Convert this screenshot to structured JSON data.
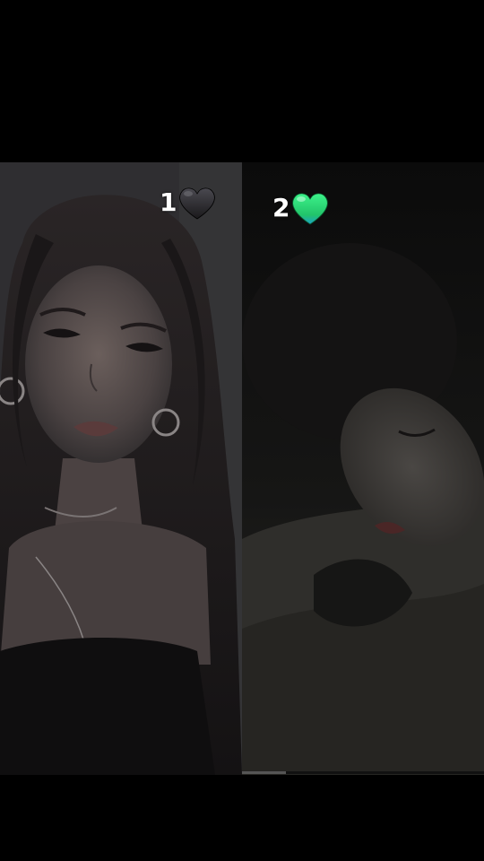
{
  "labels": {
    "option_one": {
      "number": "1",
      "heart": "black-heart-icon"
    },
    "option_two": {
      "number": "2",
      "heart": "green-heart-icon"
    }
  },
  "colors": {
    "background": "#000000",
    "black_heart": "#2b2a2d",
    "green_heart": "#2fe07c",
    "label_text": "#ffffff"
  },
  "video": {
    "progress": 0.18
  }
}
